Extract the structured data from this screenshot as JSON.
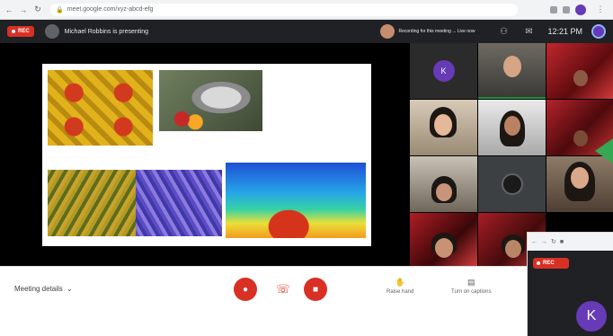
{
  "browser": {
    "url": "meet.google.com/xyz-abcd-efg",
    "back_icon": "arrow-left-icon",
    "forward_icon": "arrow-right-icon",
    "reload_icon": "reload-icon"
  },
  "meet_header": {
    "rec_label": "REC",
    "presenter_text": "Michael Robbins is presenting",
    "participant_chip_text": "Recording for this meeting ... Live now",
    "clock": "12:21 PM",
    "me_initial": "K"
  },
  "tiles": {
    "first_initial": "K"
  },
  "controls": {
    "meeting_details": "Meeting details",
    "raise_hand": "Raise hand",
    "captions": "Turn on captions"
  },
  "popup": {
    "rec_label": "REC",
    "initial": "K"
  },
  "colors": {
    "meet_dark": "#202124",
    "red": "#d93025",
    "purple": "#673ab7",
    "green": "#34a853"
  }
}
